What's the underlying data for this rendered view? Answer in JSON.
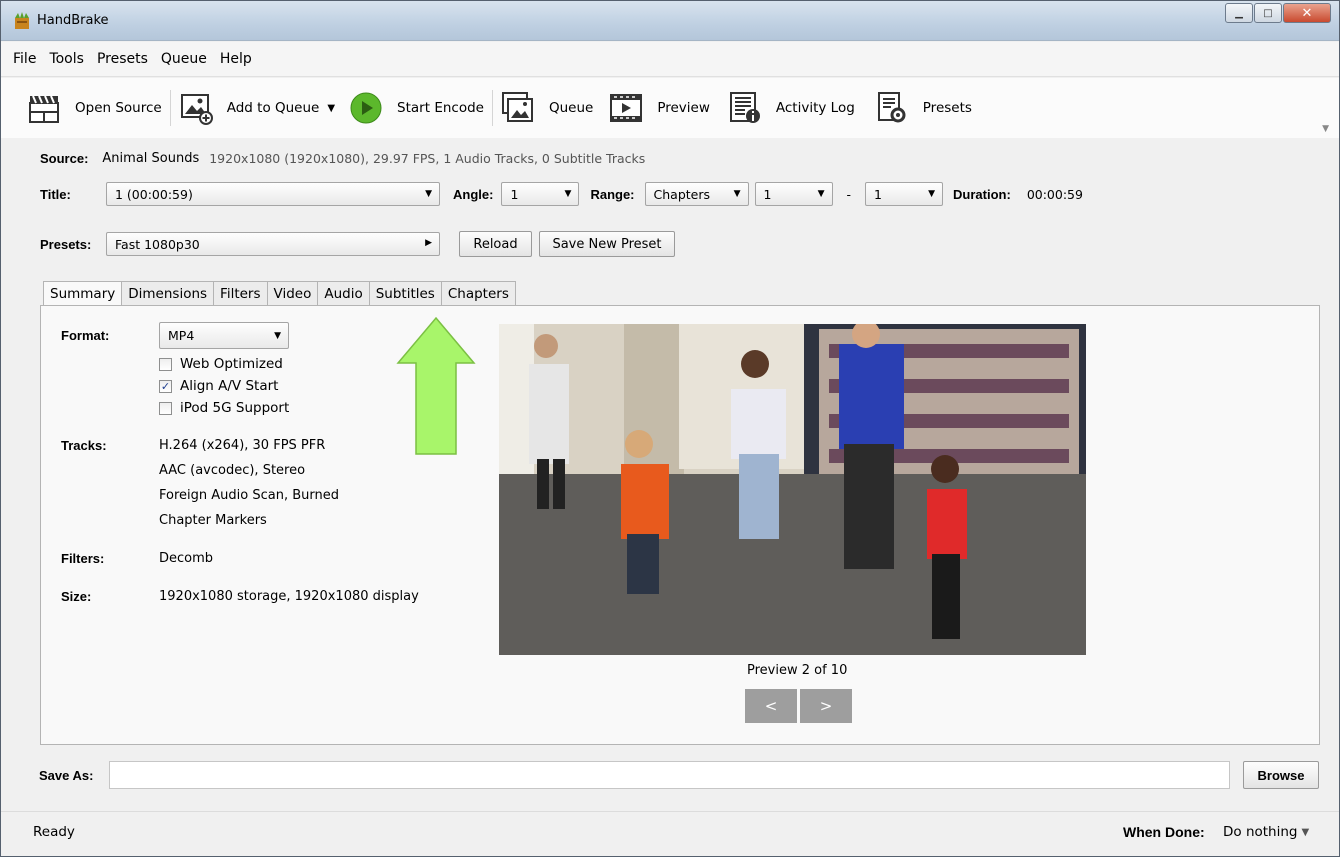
{
  "window": {
    "title": "HandBrake"
  },
  "menu": [
    "File",
    "Tools",
    "Presets",
    "Queue",
    "Help"
  ],
  "toolbar": {
    "open_source": "Open Source",
    "add_to_queue": "Add to Queue",
    "start_encode": "Start Encode",
    "queue": "Queue",
    "preview": "Preview",
    "activity_log": "Activity Log",
    "presets": "Presets"
  },
  "source": {
    "label": "Source:",
    "name": "Animal Sounds",
    "info": "1920x1080 (1920x1080), 29.97 FPS, 1 Audio Tracks, 0 Subtitle Tracks"
  },
  "title_row": {
    "title_label": "Title:",
    "title_value": "1 (00:00:59)",
    "angle_label": "Angle:",
    "angle_value": "1",
    "range_label": "Range:",
    "range_type": "Chapters",
    "range_start": "1",
    "range_dash": "-",
    "range_end": "1",
    "duration_label": "Duration:",
    "duration_value": "00:00:59"
  },
  "presets_row": {
    "label": "Presets:",
    "value": "Fast 1080p30",
    "reload": "Reload",
    "save_new": "Save New Preset"
  },
  "tabs": [
    "Summary",
    "Dimensions",
    "Filters",
    "Video",
    "Audio",
    "Subtitles",
    "Chapters"
  ],
  "summary": {
    "format_label": "Format:",
    "format_value": "MP4",
    "web_optimized": "Web Optimized",
    "align_av": "Align A/V Start",
    "ipod": "iPod 5G Support",
    "tracks_label": "Tracks:",
    "tracks": [
      "H.264 (x264), 30 FPS PFR",
      "AAC (avcodec), Stereo",
      "Foreign Audio Scan, Burned",
      "Chapter Markers"
    ],
    "filters_label": "Filters:",
    "filters_value": "Decomb",
    "size_label": "Size:",
    "size_value": "1920x1080 storage, 1920x1080 display",
    "preview_caption": "Preview 2 of 10",
    "prev": "<",
    "next": ">"
  },
  "save_as": {
    "label": "Save As:",
    "value": "",
    "browse": "Browse"
  },
  "status": {
    "text": "Ready",
    "when_done_label": "When Done:",
    "when_done_value": "Do nothing"
  },
  "colors": {
    "arrow_green": "#a8f56a",
    "nav_button": "#9e9e9e"
  }
}
